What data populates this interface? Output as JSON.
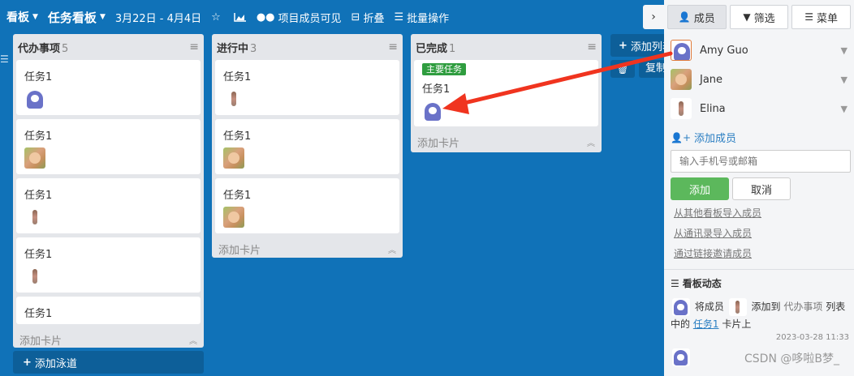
{
  "topbar": {
    "board_switch": "看板",
    "board_title": "任务看板",
    "date_range": "3月22日 - 4月4日",
    "member_visible": "项目成员可见",
    "fold": "折叠",
    "batch": "批量操作"
  },
  "lists": [
    {
      "title": "代办事项",
      "count": "5",
      "cards": [
        {
          "title": "任务1",
          "avatar": "amy"
        },
        {
          "title": "任务1",
          "avatar": "jane"
        },
        {
          "title": "任务1",
          "avatar": "elina"
        },
        {
          "title": "任务1",
          "avatar": "elina"
        },
        {
          "title": "任务1",
          "avatar": ""
        }
      ],
      "footer": "添加卡片"
    },
    {
      "title": "进行中",
      "count": "3",
      "cards": [
        {
          "title": "任务1",
          "avatar": "elina"
        },
        {
          "title": "任务1",
          "avatar": "jane"
        },
        {
          "title": "任务1",
          "avatar": "jane"
        }
      ],
      "footer": "添加卡片"
    },
    {
      "title": "已完成",
      "count": "1",
      "cards": [
        {
          "title": "任务1",
          "avatar": "amy",
          "badge": "主要任务"
        }
      ],
      "footer": "添加卡片"
    }
  ],
  "add_lane": "添加泳道",
  "add_column": "添加列表",
  "copy": "复制",
  "panel": {
    "tabs": [
      "成员",
      "筛选",
      "菜单"
    ],
    "members": [
      {
        "name": "Amy Guo",
        "avatar": "amy"
      },
      {
        "name": "Jane",
        "avatar": "jane"
      },
      {
        "name": "Elina",
        "avatar": "elina"
      }
    ],
    "add_member": "添加成员",
    "input_placeholder": "输入手机号或邮箱",
    "btn_add": "添加",
    "btn_cancel": "取消",
    "links": [
      "从其他看板导入成员",
      "从通讯录导入成员",
      "通过链接邀请成员"
    ],
    "activity_title": "看板动态",
    "activity": {
      "t1": "将成员",
      "t2": "添加到",
      "list_name": "代办事项",
      "t3": "列表",
      "t4": "中的",
      "card_name": "任务1",
      "t5": "卡片上",
      "time": "2023-03-28 11:33"
    }
  },
  "watermark": "CSDN @哆啦B梦_",
  "colors": {
    "background": "#1072b8",
    "accent": "#5cb85c",
    "link": "#2a7ec2",
    "arrow": "#f0341f"
  }
}
